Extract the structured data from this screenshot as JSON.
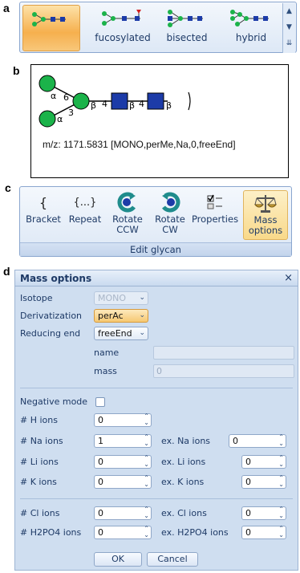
{
  "labels": {
    "a": "a",
    "b": "b",
    "c": "c",
    "d": "d"
  },
  "gallery": {
    "items": [
      {
        "label": "",
        "selected": true
      },
      {
        "label": "fucosylated"
      },
      {
        "label": "bisected"
      },
      {
        "label": "hybrid"
      }
    ]
  },
  "glycan": {
    "linkages": {
      "top": "α",
      "top_pos": "6",
      "bottom": "α",
      "bottom_pos": "3",
      "b1": "β",
      "b1_pos": "4",
      "b2": "β",
      "b2_pos": "4",
      "b3": "β"
    },
    "mz": "m/z: 1171.5831 [MONO,perMe,Na,0,freeEnd]"
  },
  "toolbar": {
    "buttons": [
      {
        "icon": "{",
        "label1": "Bracket",
        "label2": ""
      },
      {
        "icon": "{...}",
        "label1": "Repeat",
        "label2": ""
      },
      {
        "icon": "",
        "label1": "Rotate",
        "label2": "CCW"
      },
      {
        "icon": "",
        "label1": "Rotate",
        "label2": "CW"
      },
      {
        "icon": "",
        "label1": "Properties",
        "label2": ""
      },
      {
        "icon": "",
        "label1": "Mass",
        "label2": "options"
      }
    ],
    "group": "Edit glycan"
  },
  "dialog": {
    "title": "Mass options",
    "close": "×",
    "isotope": {
      "label": "Isotope",
      "value": "MONO"
    },
    "derivatization": {
      "label": "Derivatization",
      "value": "perAc"
    },
    "reducing_end": {
      "label": "Reducing end",
      "value": "freeEnd"
    },
    "name": {
      "label": "name",
      "value": ""
    },
    "mass": {
      "label": "mass",
      "value": "0"
    },
    "negative_mode": {
      "label": "Negative mode"
    },
    "h_ions": {
      "label": "# H ions",
      "value": "0"
    },
    "na_ions": {
      "label": "# Na ions",
      "value": "1",
      "ex_label": "ex. Na ions",
      "ex_value": "0"
    },
    "li_ions": {
      "label": "# Li ions",
      "value": "0",
      "ex_label": "ex. Li ions",
      "ex_value": "0"
    },
    "k_ions": {
      "label": "# K ions",
      "value": "0",
      "ex_label": "ex. K ions",
      "ex_value": "0"
    },
    "cl_ions": {
      "label": "# Cl ions",
      "value": "0",
      "ex_label": "ex. Cl ions",
      "ex_value": "0"
    },
    "h2po4_ions": {
      "label": "# H2PO4 ions",
      "value": "0",
      "ex_label": "ex. H2PO4 ions",
      "ex_value": "0"
    },
    "ok": "OK",
    "cancel": "Cancel"
  },
  "colors": {
    "green": "#1bb34a",
    "blue": "#1c3ba8",
    "accent": "#f6b04e"
  }
}
